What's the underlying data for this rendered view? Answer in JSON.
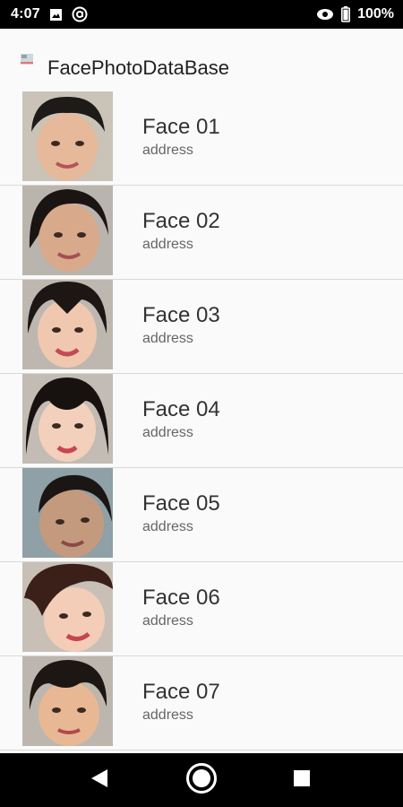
{
  "status_bar": {
    "time": "4:07",
    "battery": "100%",
    "icons": [
      "image-icon",
      "at-sign-icon",
      "eye-icon",
      "battery-icon"
    ]
  },
  "app_bar": {
    "title": "FacePhotoDataBase",
    "icon": "app-icon"
  },
  "list": {
    "items": [
      {
        "title": "Face 01",
        "subtitle": "address"
      },
      {
        "title": "Face 02",
        "subtitle": "address"
      },
      {
        "title": "Face 03",
        "subtitle": "address"
      },
      {
        "title": "Face 04",
        "subtitle": "address"
      },
      {
        "title": "Face 05",
        "subtitle": "address"
      },
      {
        "title": "Face 06",
        "subtitle": "address"
      },
      {
        "title": "Face 07",
        "subtitle": "address"
      }
    ]
  },
  "nav_bar": {
    "buttons": [
      "back-icon",
      "home-icon",
      "recents-icon"
    ]
  },
  "colors": {
    "background": "#fafafa",
    "divider": "#d8d8d8",
    "bars": "#000000"
  }
}
